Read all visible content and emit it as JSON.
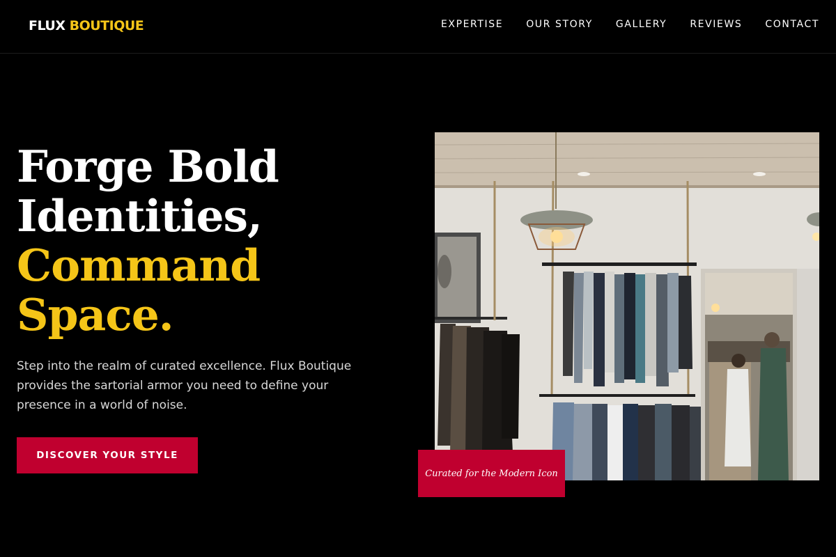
{
  "header": {
    "logo": {
      "word1": "FLUX",
      "word2": "BOUTIQUE"
    },
    "nav": [
      "EXPERTISE",
      "OUR STORY",
      "GALLERY",
      "REVIEWS",
      "CONTACT"
    ]
  },
  "hero": {
    "title_lines": [
      "Forge Bold",
      "Identities,",
      "Command",
      "Space."
    ],
    "description": "Step into the realm of curated excellence. Flux Boutique provides the sartorial armor you need to define your presence in a world of noise.",
    "cta_label": "DISCOVER YOUR STYLE",
    "image_caption": "Curated for the Modern Icon"
  },
  "colors": {
    "background": "#000000",
    "accent_yellow": "#f5c518",
    "accent_red": "#c0002f",
    "text": "#ffffff"
  }
}
